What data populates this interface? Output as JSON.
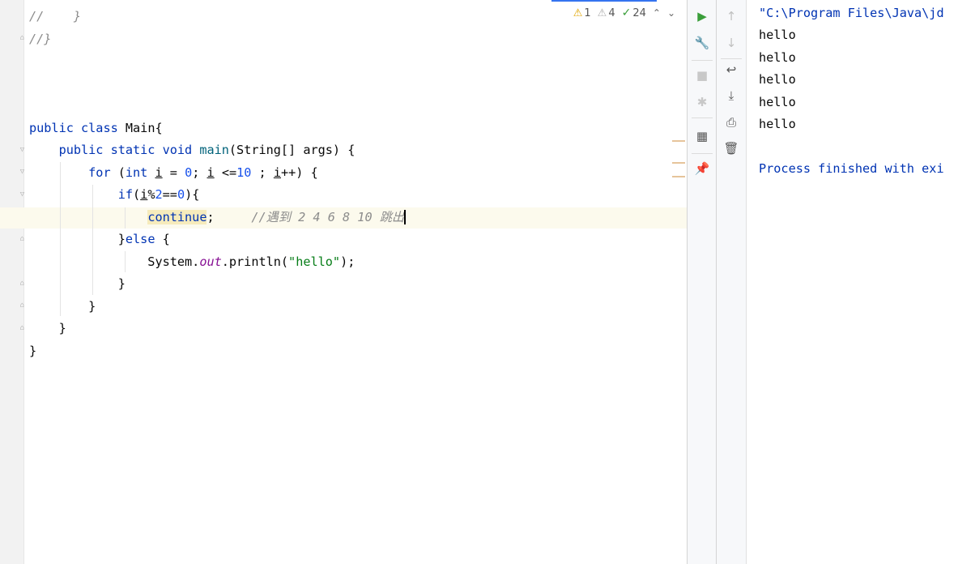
{
  "editor": {
    "lines": [
      {
        "tokens": [
          {
            "t": "//    }",
            "c": "cmt"
          }
        ]
      },
      {
        "tokens": [
          {
            "t": "//}",
            "c": "cmt"
          }
        ]
      },
      {
        "tokens": []
      },
      {
        "tokens": []
      },
      {
        "tokens": []
      },
      {
        "tokens": [
          {
            "t": "public ",
            "c": "kw"
          },
          {
            "t": "class ",
            "c": "kw"
          },
          {
            "t": "Main{",
            "c": ""
          }
        ]
      },
      {
        "tokens": [
          {
            "t": "    ",
            "c": ""
          },
          {
            "t": "public ",
            "c": "kw"
          },
          {
            "t": "static ",
            "c": "kw"
          },
          {
            "t": "void ",
            "c": "kw"
          },
          {
            "t": "main",
            "c": "fn"
          },
          {
            "t": "(String[] args) {",
            "c": ""
          }
        ]
      },
      {
        "tokens": [
          {
            "t": "        ",
            "c": ""
          },
          {
            "t": "for ",
            "c": "kw"
          },
          {
            "t": "(",
            "c": ""
          },
          {
            "t": "int ",
            "c": "kw"
          },
          {
            "t": "i",
            "c": "var"
          },
          {
            "t": " = ",
            "c": ""
          },
          {
            "t": "0",
            "c": "num"
          },
          {
            "t": "; ",
            "c": ""
          },
          {
            "t": "i",
            "c": "var"
          },
          {
            "t": " <=",
            "c": ""
          },
          {
            "t": "10",
            "c": "num"
          },
          {
            "t": " ; ",
            "c": ""
          },
          {
            "t": "i",
            "c": "var"
          },
          {
            "t": "++) {",
            "c": ""
          }
        ]
      },
      {
        "tokens": [
          {
            "t": "            ",
            "c": ""
          },
          {
            "t": "if",
            "c": "kw"
          },
          {
            "t": "(",
            "c": ""
          },
          {
            "t": "i",
            "c": "var"
          },
          {
            "t": "%",
            "c": ""
          },
          {
            "t": "2",
            "c": "num"
          },
          {
            "t": "==",
            "c": ""
          },
          {
            "t": "0",
            "c": "num"
          },
          {
            "t": "){",
            "c": ""
          }
        ]
      },
      {
        "tokens": [
          {
            "t": "                ",
            "c": ""
          },
          {
            "t": "continue",
            "c": "kw cont-hl"
          },
          {
            "t": ";     ",
            "c": ""
          },
          {
            "t": "//遇到 2 4 6 8 10 跳出",
            "c": "cmt"
          },
          {
            "t": "",
            "c": "caret"
          }
        ]
      },
      {
        "tokens": [
          {
            "t": "            ",
            "c": ""
          },
          {
            "t": "}",
            "c": ""
          },
          {
            "t": "else ",
            "c": "kw"
          },
          {
            "t": "{",
            "c": ""
          }
        ]
      },
      {
        "tokens": [
          {
            "t": "                System.",
            "c": ""
          },
          {
            "t": "out",
            "c": "fld"
          },
          {
            "t": ".println(",
            "c": ""
          },
          {
            "t": "\"hello\"",
            "c": "str"
          },
          {
            "t": ");",
            "c": ""
          }
        ]
      },
      {
        "tokens": [
          {
            "t": "            }",
            "c": ""
          }
        ]
      },
      {
        "tokens": [
          {
            "t": "        }",
            "c": ""
          }
        ]
      },
      {
        "tokens": [
          {
            "t": "    }",
            "c": ""
          }
        ]
      },
      {
        "tokens": [
          {
            "t": "}",
            "c": ""
          }
        ]
      }
    ]
  },
  "inspections": {
    "warnings": "1",
    "weak_warnings": "4",
    "typos": "24"
  },
  "toolbar_left": [
    {
      "name": "rerun-icon",
      "glyph": "▶",
      "color": "#3a9e3a"
    },
    {
      "name": "wrench-icon",
      "glyph": "🔧",
      "color": "#555555"
    },
    {
      "name": "stop-icon",
      "glyph": "■",
      "color": "#c8c8c8"
    },
    {
      "name": "debug-bug-icon",
      "glyph": "✱",
      "color": "#c8c8c8"
    },
    {
      "name": "layout-icon",
      "glyph": "▦",
      "color": "#555555"
    },
    {
      "name": "pin-icon",
      "glyph": "📌",
      "color": "#555555"
    }
  ],
  "toolbar_right": [
    {
      "name": "arrow-up-icon",
      "glyph": "↑",
      "color": "#c0c0c0"
    },
    {
      "name": "arrow-down-icon",
      "glyph": "↓",
      "color": "#c0c0c0"
    },
    {
      "name": "soft-wrap-icon",
      "glyph": "↩",
      "color": "#555555"
    },
    {
      "name": "scroll-to-end-icon",
      "glyph": "⤓",
      "color": "#555555"
    },
    {
      "name": "print-icon",
      "glyph": "⎙",
      "color": "#555555"
    },
    {
      "name": "trash-icon",
      "glyph": "🗑",
      "color": "#555555"
    }
  ],
  "console": {
    "command": "\"C:\\Program Files\\Java\\jd",
    "output": [
      "hello",
      "hello",
      "hello",
      "hello",
      "hello"
    ],
    "exit_message": "Process finished with exi"
  }
}
